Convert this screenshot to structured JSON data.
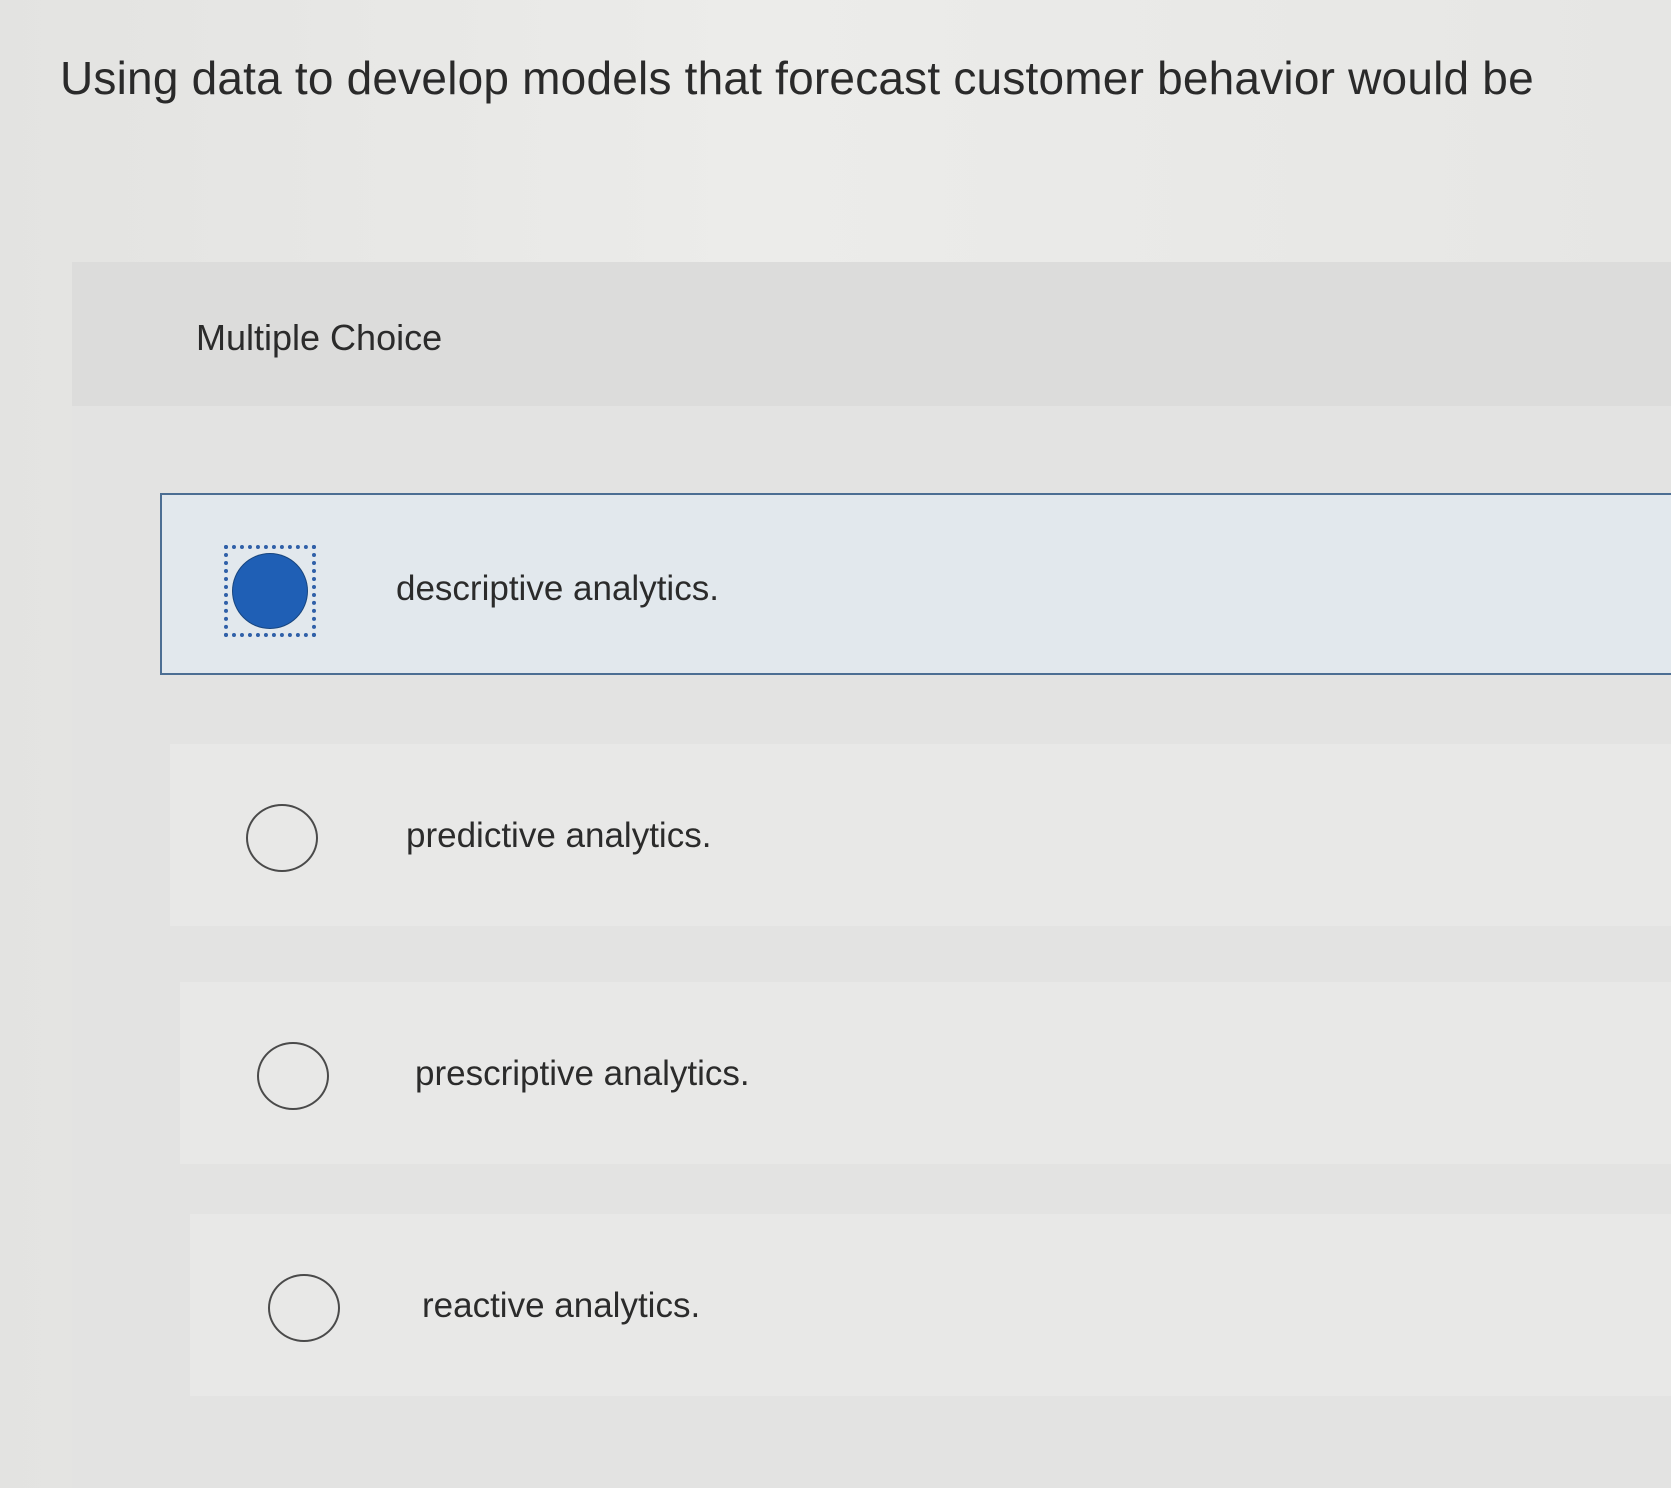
{
  "question": {
    "text": "Using data to develop models that forecast customer behavior would be"
  },
  "section": {
    "label": "Multiple Choice"
  },
  "options": [
    {
      "label": "descriptive analytics.",
      "selected": true
    },
    {
      "label": "predictive analytics.",
      "selected": false
    },
    {
      "label": "prescriptive analytics.",
      "selected": false
    },
    {
      "label": "reactive analytics.",
      "selected": false
    }
  ],
  "colors": {
    "selected_radio": "#1f5fb5",
    "selected_border": "#4c6e93",
    "focus_outline": "#3060a8"
  }
}
